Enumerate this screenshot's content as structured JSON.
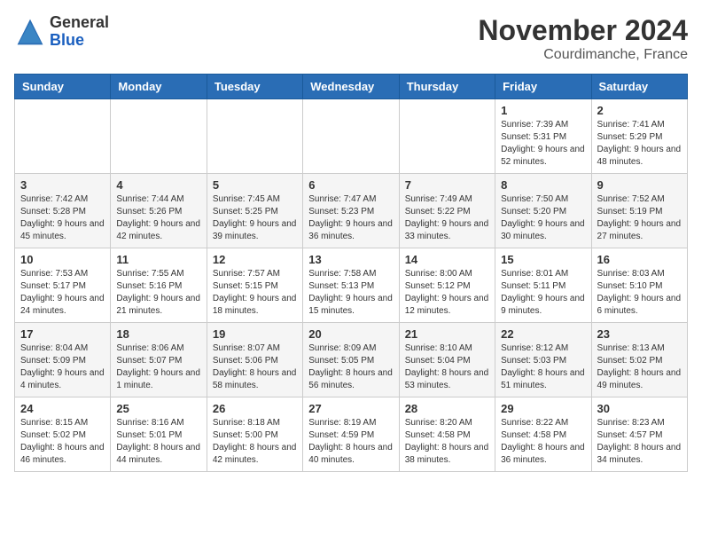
{
  "logo": {
    "general": "General",
    "blue": "Blue"
  },
  "header": {
    "title": "November 2024",
    "subtitle": "Courdimanche, France"
  },
  "columns": [
    "Sunday",
    "Monday",
    "Tuesday",
    "Wednesday",
    "Thursday",
    "Friday",
    "Saturday"
  ],
  "weeks": [
    [
      {
        "day": "",
        "info": ""
      },
      {
        "day": "",
        "info": ""
      },
      {
        "day": "",
        "info": ""
      },
      {
        "day": "",
        "info": ""
      },
      {
        "day": "",
        "info": ""
      },
      {
        "day": "1",
        "info": "Sunrise: 7:39 AM\nSunset: 5:31 PM\nDaylight: 9 hours and 52 minutes."
      },
      {
        "day": "2",
        "info": "Sunrise: 7:41 AM\nSunset: 5:29 PM\nDaylight: 9 hours and 48 minutes."
      }
    ],
    [
      {
        "day": "3",
        "info": "Sunrise: 7:42 AM\nSunset: 5:28 PM\nDaylight: 9 hours and 45 minutes."
      },
      {
        "day": "4",
        "info": "Sunrise: 7:44 AM\nSunset: 5:26 PM\nDaylight: 9 hours and 42 minutes."
      },
      {
        "day": "5",
        "info": "Sunrise: 7:45 AM\nSunset: 5:25 PM\nDaylight: 9 hours and 39 minutes."
      },
      {
        "day": "6",
        "info": "Sunrise: 7:47 AM\nSunset: 5:23 PM\nDaylight: 9 hours and 36 minutes."
      },
      {
        "day": "7",
        "info": "Sunrise: 7:49 AM\nSunset: 5:22 PM\nDaylight: 9 hours and 33 minutes."
      },
      {
        "day": "8",
        "info": "Sunrise: 7:50 AM\nSunset: 5:20 PM\nDaylight: 9 hours and 30 minutes."
      },
      {
        "day": "9",
        "info": "Sunrise: 7:52 AM\nSunset: 5:19 PM\nDaylight: 9 hours and 27 minutes."
      }
    ],
    [
      {
        "day": "10",
        "info": "Sunrise: 7:53 AM\nSunset: 5:17 PM\nDaylight: 9 hours and 24 minutes."
      },
      {
        "day": "11",
        "info": "Sunrise: 7:55 AM\nSunset: 5:16 PM\nDaylight: 9 hours and 21 minutes."
      },
      {
        "day": "12",
        "info": "Sunrise: 7:57 AM\nSunset: 5:15 PM\nDaylight: 9 hours and 18 minutes."
      },
      {
        "day": "13",
        "info": "Sunrise: 7:58 AM\nSunset: 5:13 PM\nDaylight: 9 hours and 15 minutes."
      },
      {
        "day": "14",
        "info": "Sunrise: 8:00 AM\nSunset: 5:12 PM\nDaylight: 9 hours and 12 minutes."
      },
      {
        "day": "15",
        "info": "Sunrise: 8:01 AM\nSunset: 5:11 PM\nDaylight: 9 hours and 9 minutes."
      },
      {
        "day": "16",
        "info": "Sunrise: 8:03 AM\nSunset: 5:10 PM\nDaylight: 9 hours and 6 minutes."
      }
    ],
    [
      {
        "day": "17",
        "info": "Sunrise: 8:04 AM\nSunset: 5:09 PM\nDaylight: 9 hours and 4 minutes."
      },
      {
        "day": "18",
        "info": "Sunrise: 8:06 AM\nSunset: 5:07 PM\nDaylight: 9 hours and 1 minute."
      },
      {
        "day": "19",
        "info": "Sunrise: 8:07 AM\nSunset: 5:06 PM\nDaylight: 8 hours and 58 minutes."
      },
      {
        "day": "20",
        "info": "Sunrise: 8:09 AM\nSunset: 5:05 PM\nDaylight: 8 hours and 56 minutes."
      },
      {
        "day": "21",
        "info": "Sunrise: 8:10 AM\nSunset: 5:04 PM\nDaylight: 8 hours and 53 minutes."
      },
      {
        "day": "22",
        "info": "Sunrise: 8:12 AM\nSunset: 5:03 PM\nDaylight: 8 hours and 51 minutes."
      },
      {
        "day": "23",
        "info": "Sunrise: 8:13 AM\nSunset: 5:02 PM\nDaylight: 8 hours and 49 minutes."
      }
    ],
    [
      {
        "day": "24",
        "info": "Sunrise: 8:15 AM\nSunset: 5:02 PM\nDaylight: 8 hours and 46 minutes."
      },
      {
        "day": "25",
        "info": "Sunrise: 8:16 AM\nSunset: 5:01 PM\nDaylight: 8 hours and 44 minutes."
      },
      {
        "day": "26",
        "info": "Sunrise: 8:18 AM\nSunset: 5:00 PM\nDaylight: 8 hours and 42 minutes."
      },
      {
        "day": "27",
        "info": "Sunrise: 8:19 AM\nSunset: 4:59 PM\nDaylight: 8 hours and 40 minutes."
      },
      {
        "day": "28",
        "info": "Sunrise: 8:20 AM\nSunset: 4:58 PM\nDaylight: 8 hours and 38 minutes."
      },
      {
        "day": "29",
        "info": "Sunrise: 8:22 AM\nSunset: 4:58 PM\nDaylight: 8 hours and 36 minutes."
      },
      {
        "day": "30",
        "info": "Sunrise: 8:23 AM\nSunset: 4:57 PM\nDaylight: 8 hours and 34 minutes."
      }
    ]
  ]
}
